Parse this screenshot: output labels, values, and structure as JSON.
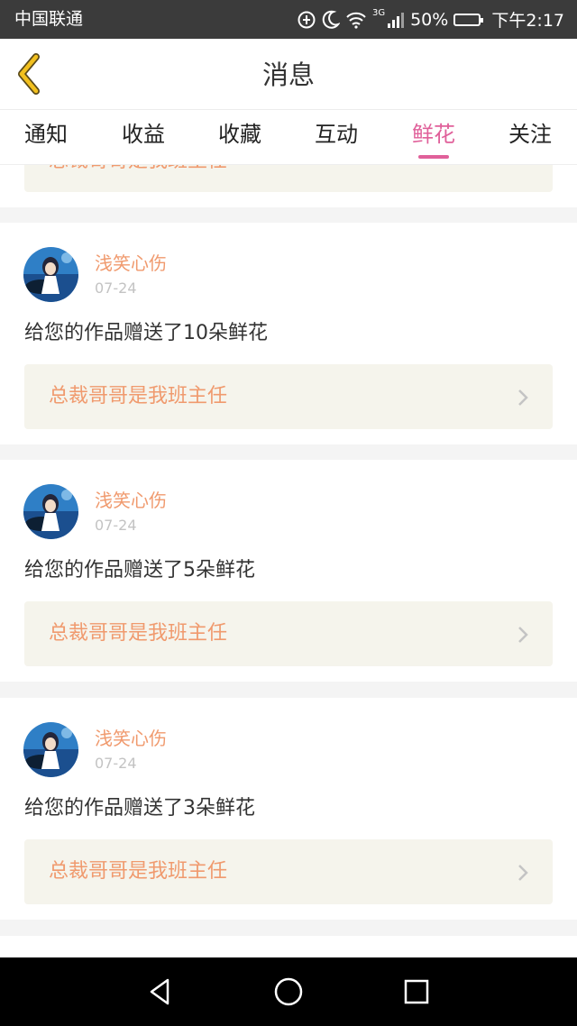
{
  "status_bar": {
    "carrier": "中国联通",
    "network": "3G",
    "battery": "50%",
    "time": "下午2:17",
    "icons": [
      "data-saver-icon",
      "moon-icon",
      "wifi-icon",
      "signal-icon",
      "battery-icon"
    ]
  },
  "header": {
    "title": "消息",
    "back_icon": "chevron-left-icon"
  },
  "tabs": [
    {
      "label": "通知",
      "active": false
    },
    {
      "label": "收益",
      "active": false
    },
    {
      "label": "收藏",
      "active": false
    },
    {
      "label": "互动",
      "active": false
    },
    {
      "label": "鲜花",
      "active": true
    },
    {
      "label": "关注",
      "active": false
    }
  ],
  "partial_card": {
    "link_title": "总裁哥哥是我班主任"
  },
  "cards": [
    {
      "username": "浅笑心伤",
      "date": "07-24",
      "message": "给您的作品赠送了10朵鲜花",
      "link_title": "总裁哥哥是我班主任"
    },
    {
      "username": "浅笑心伤",
      "date": "07-24",
      "message": "给您的作品赠送了5朵鲜花",
      "link_title": "总裁哥哥是我班主任"
    },
    {
      "username": "浅笑心伤",
      "date": "07-24",
      "message": "给您的作品赠送了3朵鲜花",
      "link_title": "总裁哥哥是我班主任"
    }
  ],
  "colors": {
    "accent_pink": "#e0609a",
    "link_orange": "#f09a6e",
    "back_yellow": "#f2c01e",
    "link_bg": "#f5f4ec"
  },
  "nav_bar": {
    "icons": [
      "back-triangle-icon",
      "home-circle-icon",
      "recents-square-icon"
    ]
  }
}
